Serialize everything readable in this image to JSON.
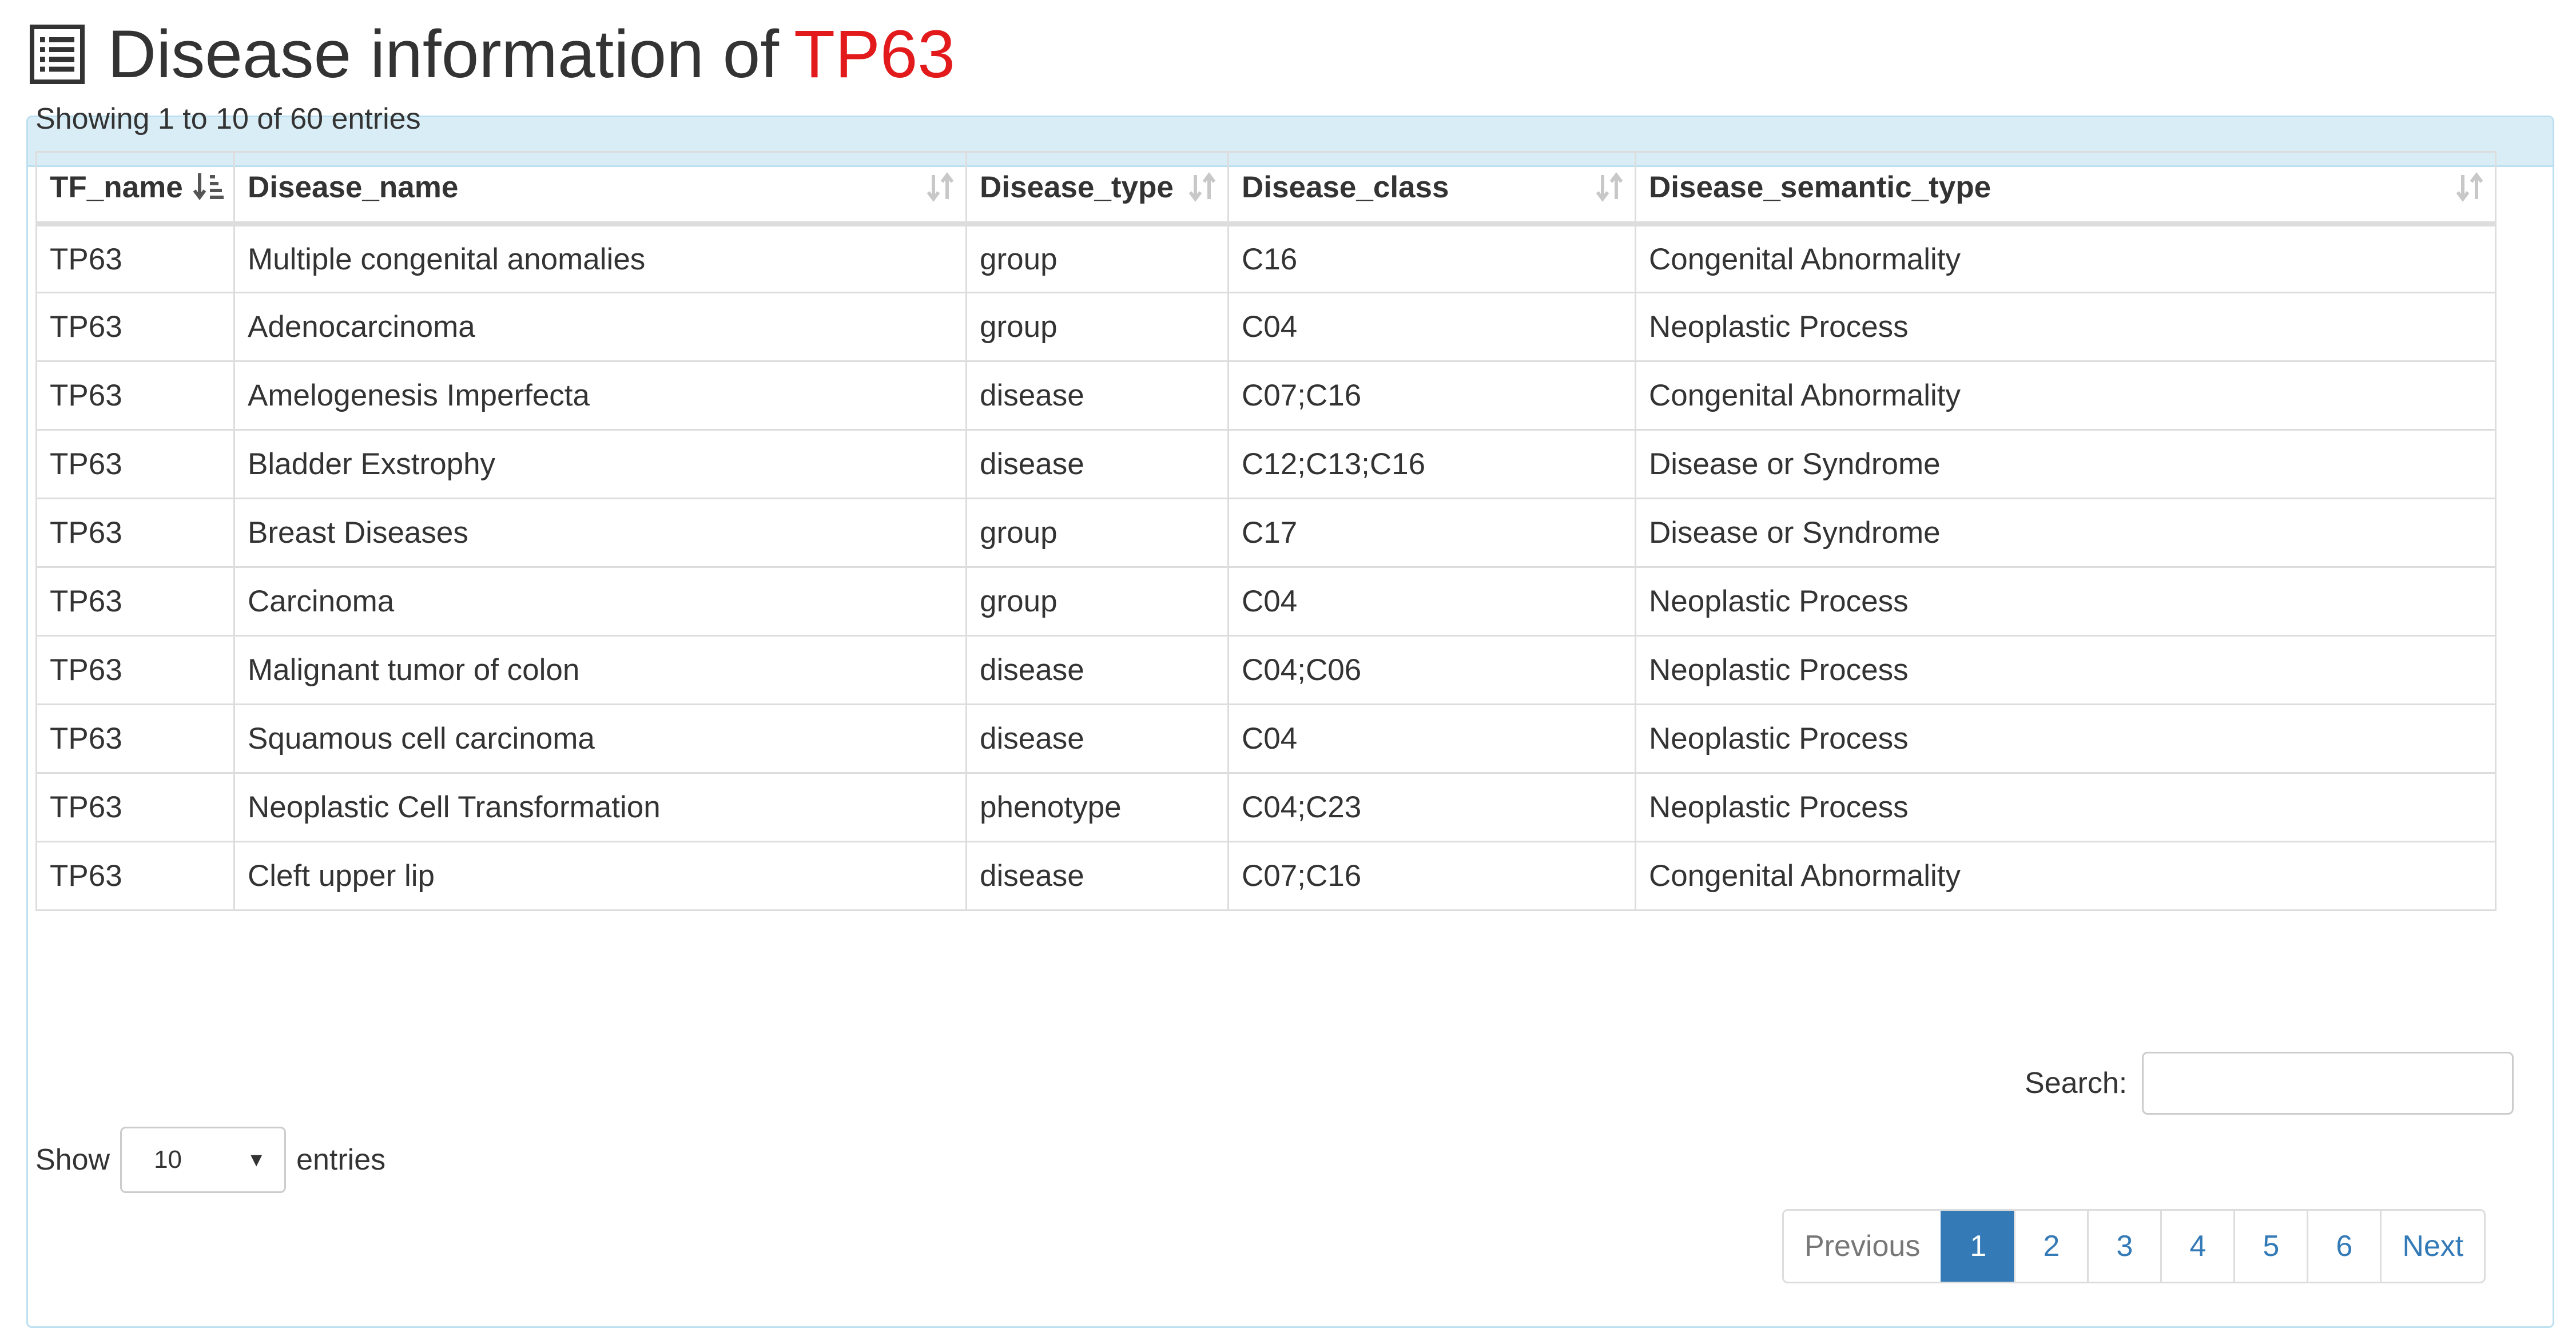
{
  "header": {
    "title_prefix": "Disease information of",
    "gene": "TP63",
    "icon": "list-alt-icon"
  },
  "table_info": "Showing 1 to 10 of 60 entries",
  "table": {
    "columns": [
      "TF_name",
      "Disease_name",
      "Disease_type",
      "Disease_class",
      "Disease_semantic_type"
    ],
    "rows": [
      [
        "TP63",
        "Multiple congenital anomalies",
        "group",
        "C16",
        "Congenital Abnormality"
      ],
      [
        "TP63",
        "Adenocarcinoma",
        "group",
        "C04",
        "Neoplastic Process"
      ],
      [
        "TP63",
        "Amelogenesis Imperfecta",
        "disease",
        "C07;C16",
        "Congenital Abnormality"
      ],
      [
        "TP63",
        "Bladder Exstrophy",
        "disease",
        "C12;C13;C16",
        "Disease or Syndrome"
      ],
      [
        "TP63",
        "Breast Diseases",
        "group",
        "C17",
        "Disease or Syndrome"
      ],
      [
        "TP63",
        "Carcinoma",
        "group",
        "C04",
        "Neoplastic Process"
      ],
      [
        "TP63",
        "Malignant tumor of colon",
        "disease",
        "C04;C06",
        "Neoplastic Process"
      ],
      [
        "TP63",
        "Squamous cell carcinoma",
        "disease",
        "C04",
        "Neoplastic Process"
      ],
      [
        "TP63",
        "Neoplastic Cell Transformation",
        "phenotype",
        "C04;C23",
        "Neoplastic Process"
      ],
      [
        "TP63",
        "Cleft upper lip",
        "disease",
        "C07;C16",
        "Congenital Abnormality"
      ]
    ]
  },
  "search": {
    "label": "Search:",
    "value": ""
  },
  "length": {
    "show_label": "Show",
    "selected": "10",
    "entries_label": "entries"
  },
  "pagination": {
    "previous": "Previous",
    "pages": [
      "1",
      "2",
      "3",
      "4",
      "5",
      "6"
    ],
    "active": "1",
    "next": "Next"
  },
  "colors": {
    "accent": "#337ab7",
    "gene_highlight": "#e31a1c",
    "panel_heading": "#d9edf7"
  }
}
